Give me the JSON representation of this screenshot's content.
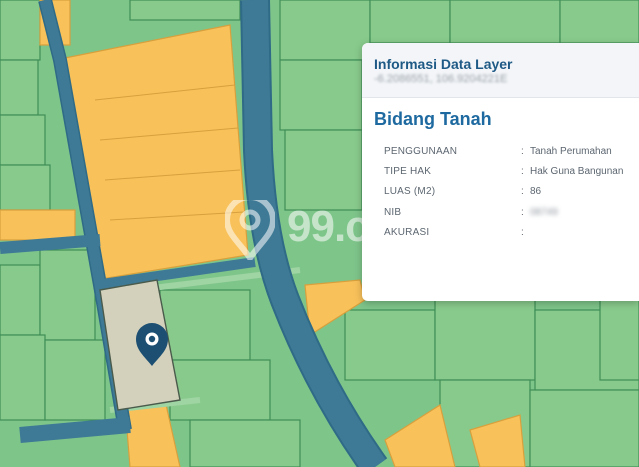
{
  "panel": {
    "title": "Informasi Data Layer",
    "coordinates": "-6.2086551, 106.9204221E",
    "heading": "Bidang Tanah",
    "rows": [
      {
        "key": "PENGGUNAAN",
        "sep": ":",
        "value": "Tanah Perumahan"
      },
      {
        "key": "TIPE HAK",
        "sep": ":",
        "value": "Hak Guna Bangunan"
      },
      {
        "key": "LUAS (M2)",
        "sep": ":",
        "value": "86"
      },
      {
        "key": "NIB",
        "sep": ":",
        "value": "08749"
      },
      {
        "key": "AKURASI",
        "sep": ":",
        "value": ""
      }
    ]
  },
  "watermark": {
    "text": "99.c"
  },
  "map": {
    "colors": {
      "residential": "#86c98b",
      "commercial": "#f8c15a",
      "road": "#3e7a95",
      "road_edge": "#2f6a86",
      "selected_parcel": "#d3d1bb",
      "marker": "#1c4f72"
    },
    "icons": [
      "location-pin-icon",
      "watermark-logo-icon"
    ]
  }
}
